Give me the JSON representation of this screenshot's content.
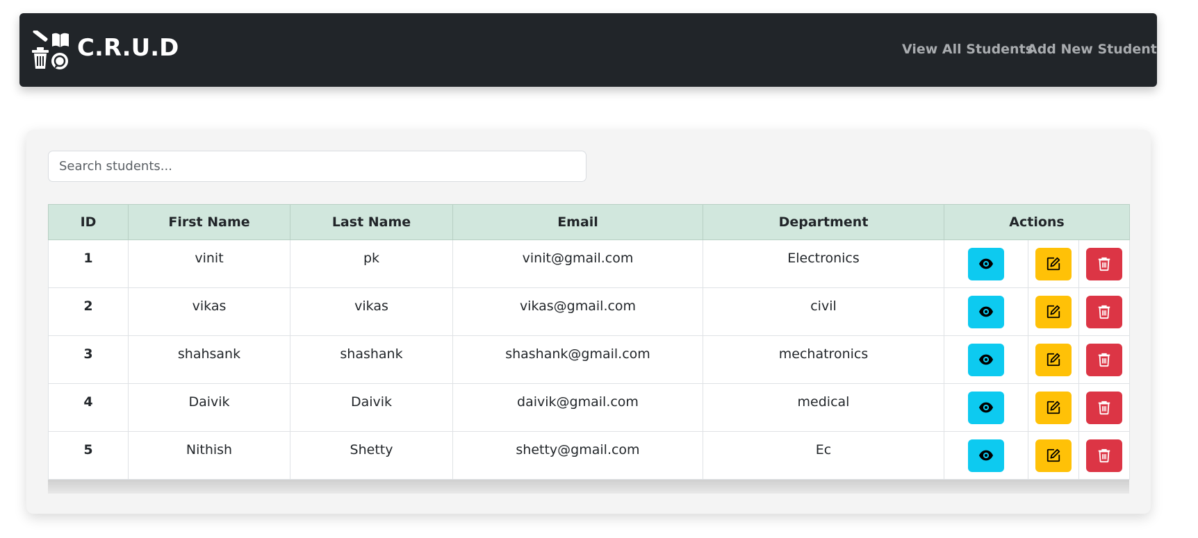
{
  "nav": {
    "brand": "C.R.U.D",
    "brand_icon": "crud-logo-icon",
    "links": [
      "View All Students",
      "Add New Student"
    ],
    "bg_color": "#212529"
  },
  "search": {
    "placeholder": "Search students..."
  },
  "table": {
    "headers": [
      "ID",
      "First Name",
      "Last Name",
      "Email",
      "Department",
      "Actions"
    ],
    "header_bg": "#d1e7dd",
    "rows": [
      {
        "id": "1",
        "first": "vinit",
        "last": "pk",
        "email": "vinit@gmail.com",
        "dept": "Electronics"
      },
      {
        "id": "2",
        "first": "vikas",
        "last": "vikas",
        "email": "vikas@gmail.com",
        "dept": "civil"
      },
      {
        "id": "3",
        "first": "shahsank",
        "last": "shashank",
        "email": "shashank@gmail.com",
        "dept": "mechatronics"
      },
      {
        "id": "4",
        "first": "Daivik",
        "last": "Daivik",
        "email": "daivik@gmail.com",
        "dept": "medical"
      },
      {
        "id": "5",
        "first": "Nithish",
        "last": "Shetty",
        "email": "shetty@gmail.com",
        "dept": "Ec"
      }
    ],
    "actions": [
      {
        "name": "view",
        "icon": "eye-icon",
        "color": "#0dcaf0"
      },
      {
        "name": "edit",
        "icon": "edit-icon",
        "color": "#ffc107"
      },
      {
        "name": "delete",
        "icon": "trash-icon",
        "color": "#dc3545"
      }
    ]
  }
}
